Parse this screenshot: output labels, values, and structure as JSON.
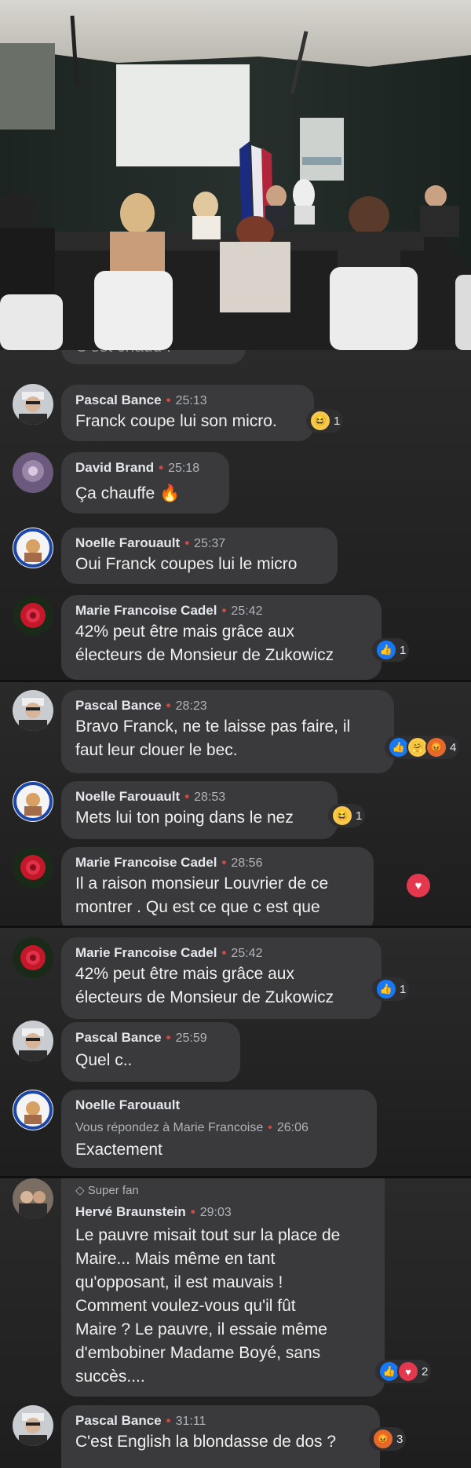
{
  "comments_a": [
    {
      "name": "Pascal Bance",
      "time": "25:13",
      "text": "Franck coupe lui son micro.",
      "reaction_count": "1"
    },
    {
      "name": "David Brand",
      "time": "25:18",
      "text": "Ça chauffe 🔥"
    },
    {
      "name": "Noelle Farouault",
      "time": "25:37",
      "text": "Oui Franck coupes lui le micro"
    },
    {
      "name": "Marie Francoise Cadel",
      "time": "25:42",
      "text": "42% peut être mais grâce aux\nélecteurs de Monsieur de Zukowicz",
      "reaction_count": "1"
    }
  ],
  "partial_top_text": "C'est chaud !",
  "comments_b": [
    {
      "name": "Pascal Bance",
      "time": "28:23",
      "text": "Bravo Franck, ne te laisse pas faire, il\nfaut leur clouer le bec.",
      "reaction_count": "4"
    },
    {
      "name": "Noelle Farouault",
      "time": "28:53",
      "text": "Mets lui ton poing dans le nez",
      "reaction_count": "1"
    },
    {
      "name": "Marie Francoise Cadel",
      "time": "28:56",
      "text": "Il a raison monsieur Louvrier de ce\nmontrer . Qu est ce que c est que"
    }
  ],
  "comments_c": [
    {
      "name": "Marie Francoise Cadel",
      "time": "25:42",
      "text": "42% peut être mais grâce aux\nélecteurs de Monsieur de Zukowicz",
      "reaction_count": "1"
    },
    {
      "name": "Pascal Bance",
      "time": "25:59",
      "text": "Quel c.."
    },
    {
      "name": "Noelle Farouault",
      "reply_to": "Vous répondez à Marie Francoise",
      "time": "26:06",
      "text": "Exactement"
    }
  ],
  "comments_d": [
    {
      "badge": "Super fan",
      "name": "Hervé Braunstein",
      "time": "29:03",
      "text": "Le pauvre misait tout sur la place de\nMaire... Mais même en tant\nqu'opposant, il est mauvais !\nComment voulez-vous qu'il fût\nMaire ? Le pauvre, il essaie même\nd'embobiner Madame Boyé, sans\nsuccès....",
      "reaction_count": "2"
    },
    {
      "name": "Pascal Bance",
      "time": "31:11",
      "text": "C'est English la blondasse de dos ?",
      "reaction_count": "3"
    }
  ],
  "icons": {
    "like": "thumbs-up-icon",
    "heart": "heart-icon",
    "haha": "laugh-emoji-icon",
    "angry": "angry-emoji-icon",
    "care": "care-emoji-icon",
    "diamond": "diamond-icon"
  }
}
